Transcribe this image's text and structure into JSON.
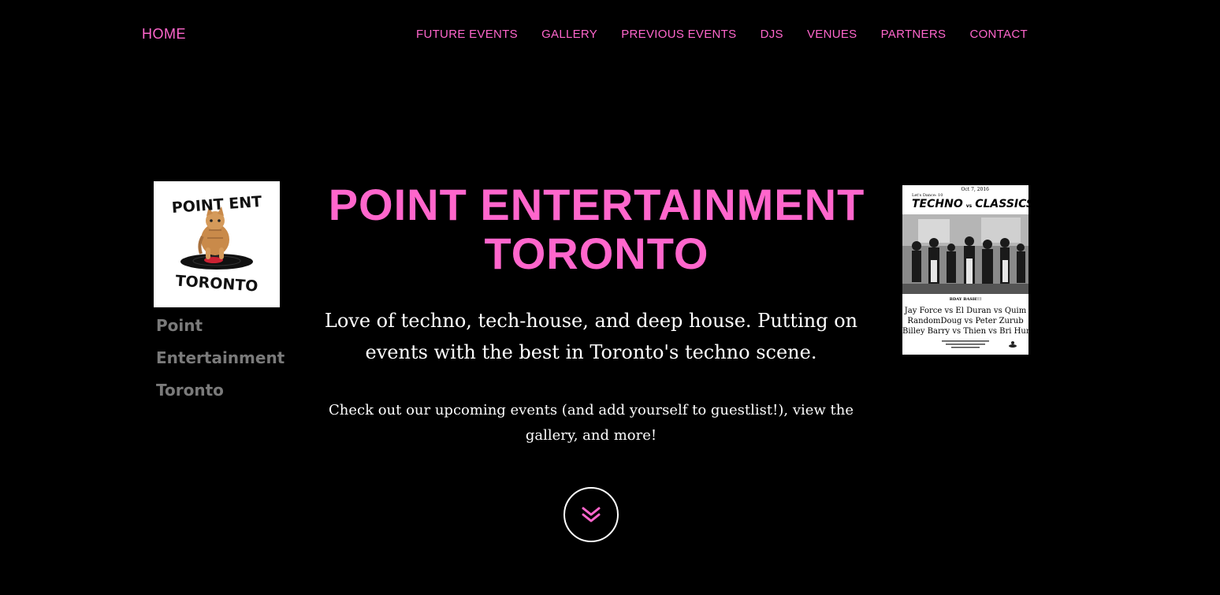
{
  "nav": {
    "home_label": "HOME",
    "items": [
      {
        "label": "FUTURE EVENTS"
      },
      {
        "label": "GALLERY"
      },
      {
        "label": "PREVIOUS EVENTS"
      },
      {
        "label": "DJS"
      },
      {
        "label": "VENUES"
      },
      {
        "label": "PARTNERS"
      },
      {
        "label": "CONTACT"
      }
    ]
  },
  "logo": {
    "top_text": "POINT ENT",
    "bottom_text": "TORONTO",
    "caption_lines": [
      "Point",
      "Entertainment",
      "Toronto"
    ]
  },
  "hero": {
    "title_line1": "POINT ENTERTAINMENT",
    "title_line2": "TORONTO",
    "tagline": "Love of techno, tech-house, and deep house. Putting on events with the best in Toronto's techno scene.",
    "description": "Check out our upcoming events (and add yourself to guestlist!), view the gallery, and more!",
    "scroll_icon": "double-chevron-down-icon"
  },
  "poster": {
    "date": "Oct 7, 2016",
    "subtitle": "Let's Dance: 10",
    "title_left": "TECHNO",
    "title_vs": "vs",
    "title_right": "CLASSICS",
    "bday": "BDAY BASH!!!",
    "lineup": [
      "Jay Force vs El Duran vs Quim",
      "RandomDoug vs Peter Zurub",
      "Billey Barry vs Thien vs Bri Hunter"
    ]
  },
  "colors": {
    "accent": "#ff66cc",
    "background": "#000000",
    "text": "#ffffff",
    "caption": "#7a7a7a"
  }
}
